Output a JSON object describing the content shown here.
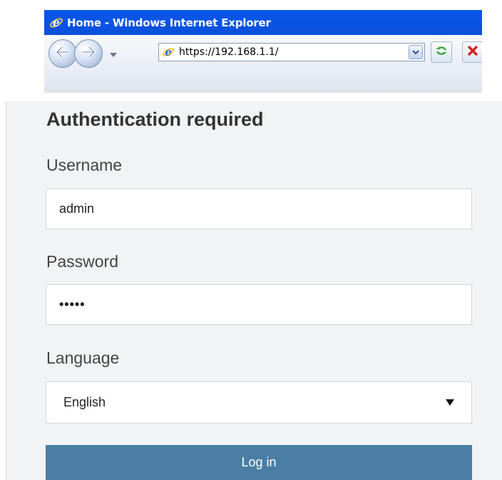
{
  "browser": {
    "window_title": "Home - Windows Internet Explorer",
    "address_url": "https://192.168.1.1/",
    "icons": {
      "app_logo": "internet-explorer-icon",
      "back": "back-arrow-icon",
      "forward": "forward-arrow-icon",
      "history_dropdown": "chevron-down-icon",
      "address_page_icon": "internet-explorer-icon",
      "address_dropdown": "chevron-down-icon",
      "refresh": "refresh-icon",
      "stop": "stop-x-icon"
    },
    "colors": {
      "titlebar": "#0a56e8",
      "refresh_arrows": "#3aa83a",
      "stop": "#d42020"
    }
  },
  "auth": {
    "heading": "Authentication required",
    "username_label": "Username",
    "username_value": "admin",
    "password_label": "Password",
    "password_value": "•••••",
    "language_label": "Language",
    "language_selected": "English",
    "login_label": "Log in"
  },
  "colors": {
    "page_background": "#f2f3f4",
    "login_button": "#4a7ea5"
  }
}
